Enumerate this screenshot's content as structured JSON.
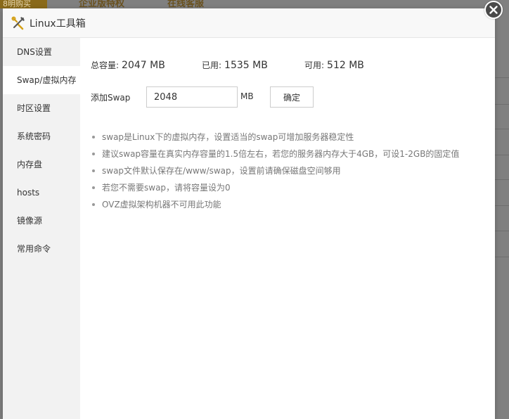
{
  "background": {
    "badge_text": "8明购买",
    "top_text_1": "企业版特权",
    "top_text_2": "在线客服"
  },
  "modal": {
    "title": "Linux工具箱",
    "title_icon": "tools-icon",
    "close_icon": "close-icon"
  },
  "sidebar": {
    "items": [
      {
        "label": "DNS设置"
      },
      {
        "label": "Swap/虚拟内存"
      },
      {
        "label": "时区设置"
      },
      {
        "label": "系统密码"
      },
      {
        "label": "内存盘"
      },
      {
        "label": "hosts"
      },
      {
        "label": "镜像源"
      },
      {
        "label": "常用命令"
      }
    ],
    "active_index": 1
  },
  "swap": {
    "total_label": "总容量:",
    "total_value": "2047 MB",
    "used_label": "已用:",
    "used_value": "1535 MB",
    "free_label": "可用:",
    "free_value": "512 MB",
    "add_label": "添加Swap",
    "input_value": "2048",
    "unit": "MB",
    "confirm_label": "确定"
  },
  "tips": [
    "swap是Linux下的虚拟内存，设置适当的swap可增加服务器稳定性",
    "建议swap容量在真实内存容量的1.5倍左右，若您的服务器内存大于4GB，可设1-2GB的固定值",
    "swap文件默认保存在/www/swap，设置前请确保磁盘空间够用",
    "若您不需要swap，请将容量设为0",
    "OVZ虚拟架构机器不可用此功能"
  ],
  "colors": {
    "overlay": "#808080",
    "sidebar_bg": "#f2f2f2",
    "header_bg": "#f8f8f8",
    "icon_accent": "#d4a017",
    "tip_text": "#777777"
  }
}
